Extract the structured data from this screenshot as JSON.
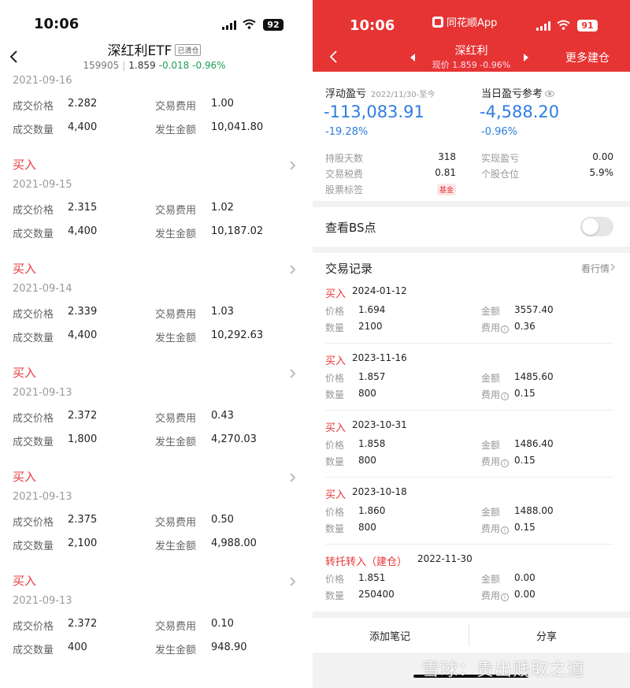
{
  "left": {
    "status": {
      "time": "10:06",
      "battery": "92"
    },
    "title": "深红利ETF",
    "cleared_badge": "已清仓",
    "code": "159905",
    "price": "1.859",
    "change": "-0.018 -0.96%",
    "top_date": "2021-09-16",
    "labels": {
      "price": "成交价格",
      "fee": "交易费用",
      "qty": "成交数量",
      "amount": "发生金额",
      "buy": "买入"
    },
    "records": [
      {
        "date": "2021-09-16",
        "price": "2.282",
        "fee": "1.00",
        "qty": "4,400",
        "amount": "10,041.80"
      },
      {
        "date": "2021-09-15",
        "price": "2.315",
        "fee": "1.02",
        "qty": "4,400",
        "amount": "10,187.02"
      },
      {
        "date": "2021-09-14",
        "price": "2.339",
        "fee": "1.03",
        "qty": "4,400",
        "amount": "10,292.63"
      },
      {
        "date": "2021-09-13",
        "price": "2.372",
        "fee": "0.43",
        "qty": "1,800",
        "amount": "4,270.03"
      },
      {
        "date": "2021-09-13",
        "price": "2.375",
        "fee": "0.50",
        "qty": "2,100",
        "amount": "4,988.00"
      },
      {
        "date": "2021-09-13",
        "price": "2.372",
        "fee": "0.10",
        "qty": "400",
        "amount": "948.90"
      }
    ]
  },
  "right": {
    "status": {
      "time": "10:06",
      "app": "同花顺App",
      "battery": "91"
    },
    "title": "深红利",
    "price_line": "现价 1.859 -0.96%",
    "more": "更多建仓",
    "float_pl": {
      "label": "浮动盈亏",
      "since": "2022/11/30-至今",
      "value": "-113,083.91",
      "pct": "-19.28%"
    },
    "day_pl": {
      "label": "当日盈亏参考",
      "value": "-4,588.20",
      "pct": "-0.96%"
    },
    "stats": {
      "hold_days_label": "持股天数",
      "hold_days": "318",
      "realized_label": "实现盈亏",
      "realized": "0.00",
      "tax_label": "交易税费",
      "tax": "0.81",
      "position_label": "个股仓位",
      "position": "5.9%",
      "tag_label": "股票标签",
      "tag": "基金"
    },
    "bs_label": "查看BS点",
    "records_title": "交易记录",
    "quote_link": "看行情",
    "labels": {
      "price": "价格",
      "qty": "数量",
      "amount": "金额",
      "fee": "费用"
    },
    "records": [
      {
        "type": "买入",
        "date": "2024-01-12",
        "price": "1.694",
        "qty": "2100",
        "amount": "3557.40",
        "fee": "0.36"
      },
      {
        "type": "买入",
        "date": "2023-11-16",
        "price": "1.857",
        "qty": "800",
        "amount": "1485.60",
        "fee": "0.15"
      },
      {
        "type": "买入",
        "date": "2023-10-31",
        "price": "1.858",
        "qty": "800",
        "amount": "1486.40",
        "fee": "0.15"
      },
      {
        "type": "买入",
        "date": "2023-10-18",
        "price": "1.860",
        "qty": "800",
        "amount": "1488.00",
        "fee": "0.15"
      },
      {
        "type": "转托转入（建仓）",
        "date": "2022-11-30",
        "price": "1.851",
        "qty": "250400",
        "amount": "0.00",
        "fee": "0.00"
      }
    ],
    "footer": {
      "add_note": "添加笔记",
      "share": "分享"
    },
    "watermark": "雪球：贵出贱取之道"
  },
  "colors": {
    "accent_red": "#e63434",
    "loss_blue": "#2d7de0",
    "gain_green": "#1e9e56"
  }
}
